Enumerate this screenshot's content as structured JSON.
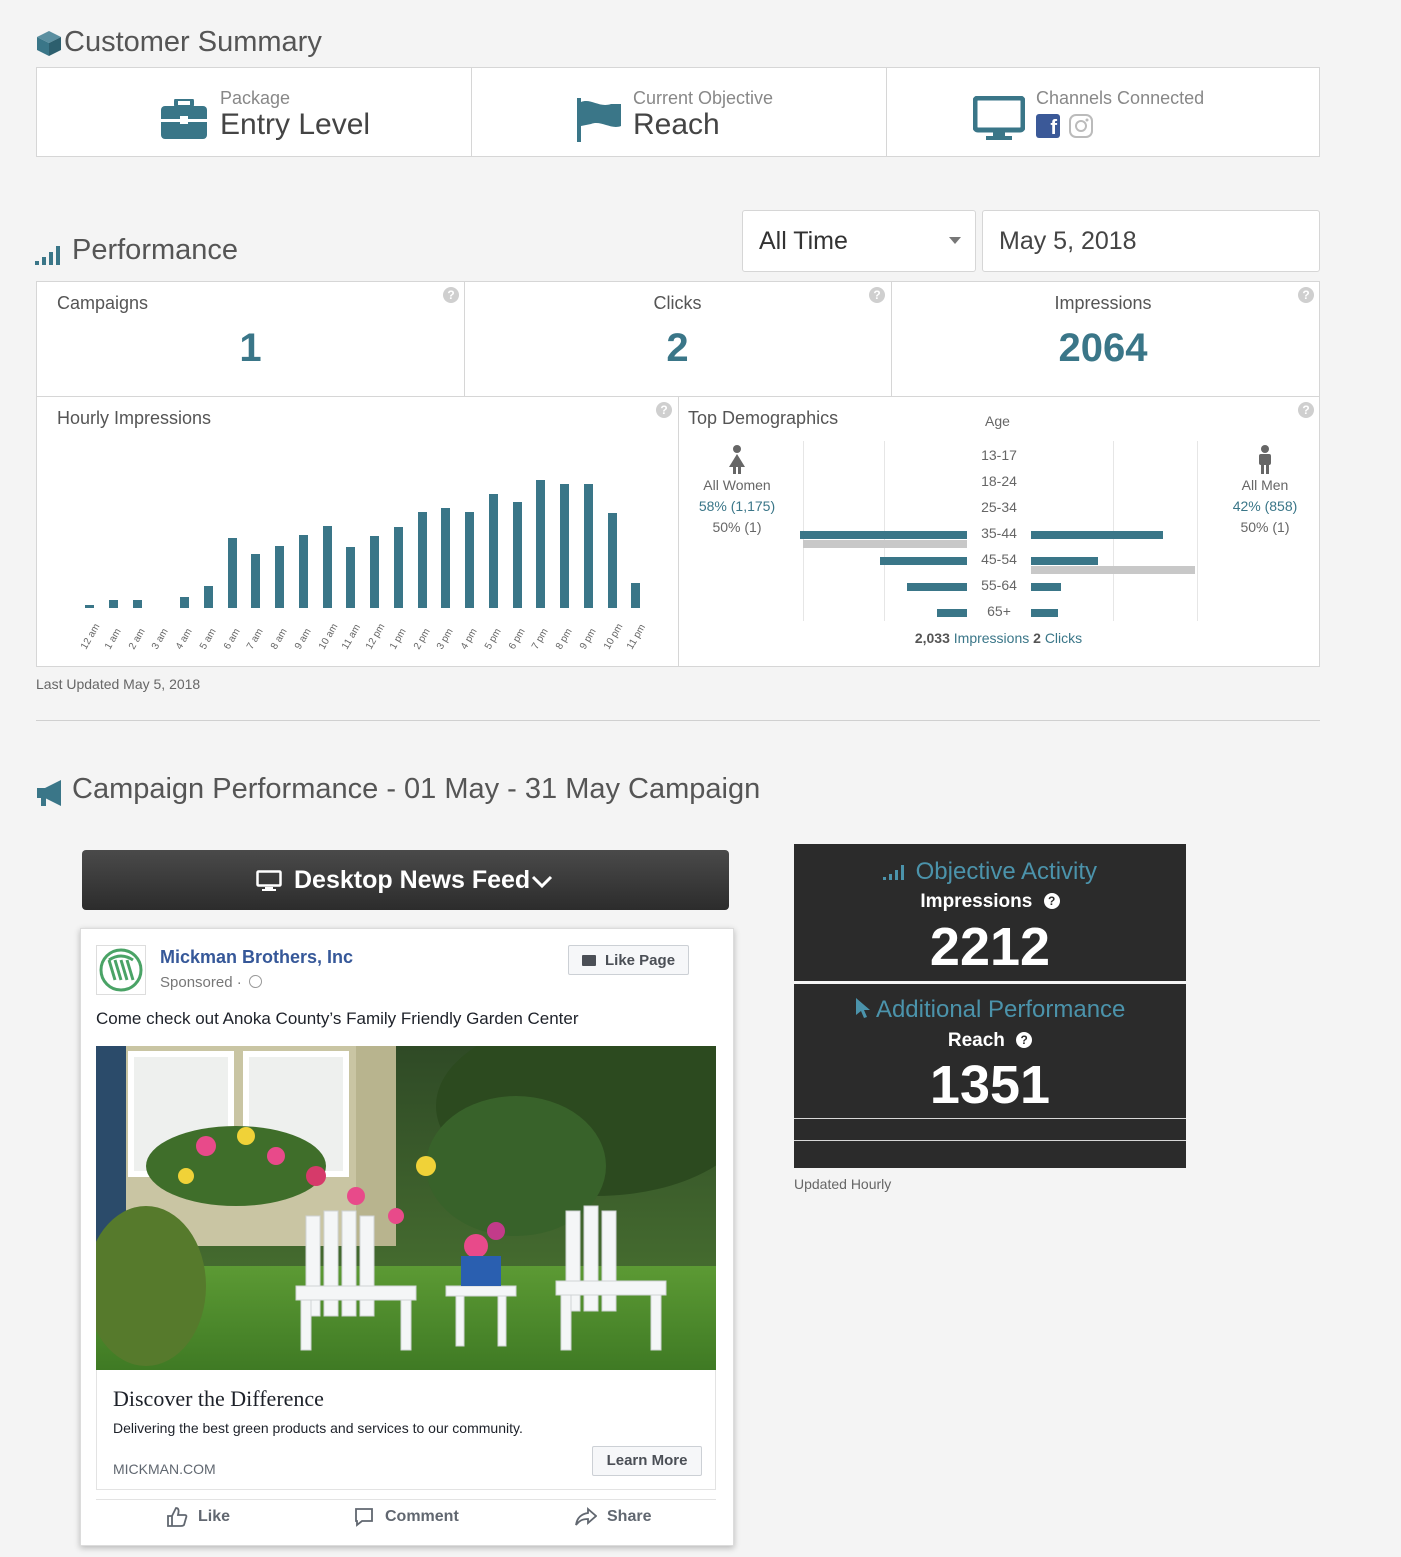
{
  "customer_summary": {
    "title": "Customer Summary",
    "package_label": "Package",
    "package_value": "Entry Level",
    "objective_label": "Current Objective",
    "objective_value": "Reach",
    "channels_label": "Channels Connected",
    "channels": [
      "facebook-icon",
      "instagram-icon"
    ]
  },
  "performance": {
    "title": "Performance",
    "range_select": "All Time",
    "date_value": "May 5, 2018",
    "stats": [
      {
        "label": "Campaigns",
        "value": "1"
      },
      {
        "label": "Clicks",
        "value": "2"
      },
      {
        "label": "Impressions",
        "value": "2064"
      }
    ],
    "hourly_title": "Hourly Impressions",
    "demographics_title": "Top Demographics",
    "age_header": "Age",
    "women_label": "All Women",
    "women_pct": "58% (1,175)",
    "women_clicks": "50% (1)",
    "men_label": "All Men",
    "men_pct": "42% (858)",
    "men_clicks": "50% (1)",
    "footer_impressions_num": "2,033",
    "footer_impressions_word": "Impressions",
    "footer_clicks_num": "2",
    "footer_clicks_word": "Clicks",
    "last_updated": "Last Updated May 5, 2018"
  },
  "chart_data": [
    {
      "type": "bar",
      "title": "Hourly Impressions",
      "categories": [
        "12 am",
        "1 am",
        "2 am",
        "3 am",
        "4 am",
        "5 am",
        "6 am",
        "7 am",
        "8 am",
        "9 am",
        "10 am",
        "11 am",
        "12 pm",
        "1 pm",
        "2 pm",
        "3 pm",
        "4 pm",
        "5 pm",
        "6 pm",
        "7 pm",
        "8 pm",
        "9 pm",
        "10 pm",
        "11 pm"
      ],
      "values": [
        2,
        5,
        5,
        0,
        7,
        14,
        45,
        35,
        40,
        47,
        53,
        39,
        46,
        52,
        62,
        64,
        62,
        73,
        68,
        82,
        80,
        80,
        61,
        16
      ],
      "ylim": [
        0,
        90
      ]
    },
    {
      "type": "bar",
      "title": "Top Demographics",
      "categories": [
        "13-17",
        "18-24",
        "25-34",
        "35-44",
        "45-54",
        "55-64",
        "65+"
      ],
      "series": [
        {
          "name": "All Women",
          "impressions": [
            0,
            0,
            0,
            500,
            260,
            180,
            90
          ],
          "clicks": [
            0,
            0,
            0,
            1,
            0,
            0,
            0
          ]
        },
        {
          "name": "All Men",
          "impressions": [
            0,
            0,
            0,
            395,
            200,
            90,
            80
          ],
          "clicks": [
            0,
            0,
            0,
            0,
            1,
            0,
            0
          ]
        }
      ]
    }
  ],
  "campaign": {
    "title": "Campaign Performance - 01 May - 31 May Campaign",
    "placement_select": "Desktop News Feed",
    "ad": {
      "page_name": "Mickman Brothers, Inc",
      "sponsored": "Sponsored ·",
      "like_page": "Like Page",
      "text": "Come check out Anoka County’s Family Friendly Garden Center",
      "headline": "Discover the Difference",
      "description": "Delivering the best green products and services to our community.",
      "domain": "MICKMAN.COM",
      "cta": "Learn More",
      "actions": [
        "Like",
        "Comment",
        "Share"
      ]
    },
    "objective_title": "Objective Activity",
    "objective_metric": "Impressions",
    "objective_value": "2212",
    "additional_title": "Additional Performance",
    "additional_metric": "Reach",
    "additional_value": "1351",
    "updated": "Updated Hourly"
  },
  "colors": {
    "accent": "#3a7688",
    "dark_panel": "#2b2b2b",
    "facebook": "#3b5998"
  }
}
